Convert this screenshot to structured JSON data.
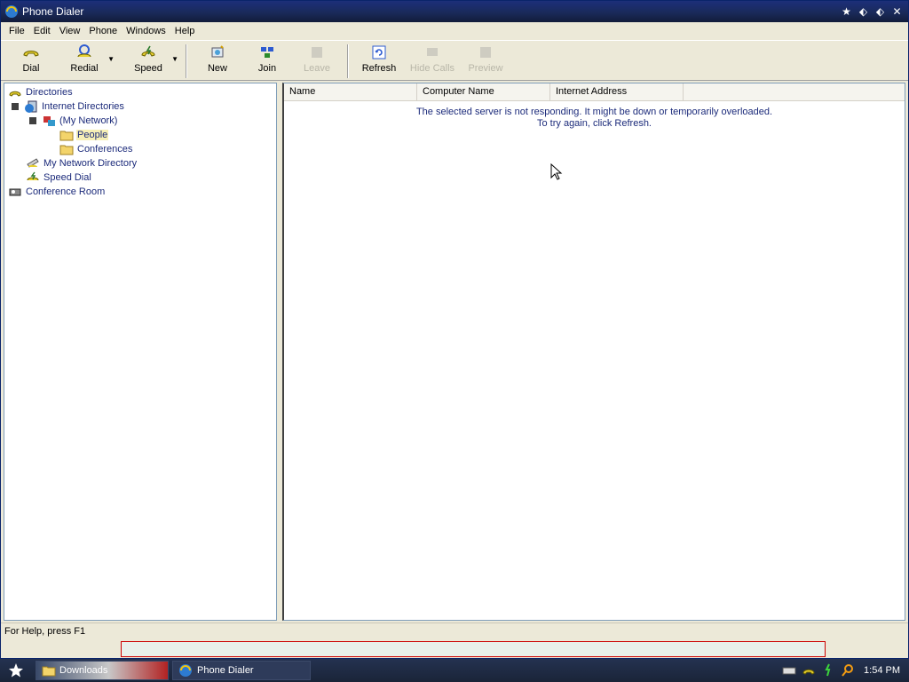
{
  "window": {
    "title": "Phone Dialer"
  },
  "menu": [
    "File",
    "Edit",
    "View",
    "Phone",
    "Windows",
    "Help"
  ],
  "toolbar": {
    "dial": "Dial",
    "redial": "Redial",
    "speed": "Speed",
    "new": "New",
    "join": "Join",
    "leave": "Leave",
    "refresh": "Refresh",
    "hide_calls": "Hide Calls",
    "preview": "Preview"
  },
  "tree": {
    "directories": "Directories",
    "internet_directories": "Internet Directories",
    "my_network": "(My Network)",
    "people": "People",
    "conferences": "Conferences",
    "my_network_directory": "My Network Directory",
    "speed_dial": "Speed Dial",
    "conference_room": "Conference Room"
  },
  "list": {
    "columns": [
      "Name",
      "Computer Name",
      "Internet Address"
    ],
    "message_line1": "The selected server is not responding. It might be down or temporarily overloaded.",
    "message_line2": "To try again, click Refresh."
  },
  "status": {
    "text": "For Help, press F1"
  },
  "taskbar": {
    "downloads": "Downloads",
    "dialer": "Phone Dialer",
    "clock": "1:54 PM"
  }
}
